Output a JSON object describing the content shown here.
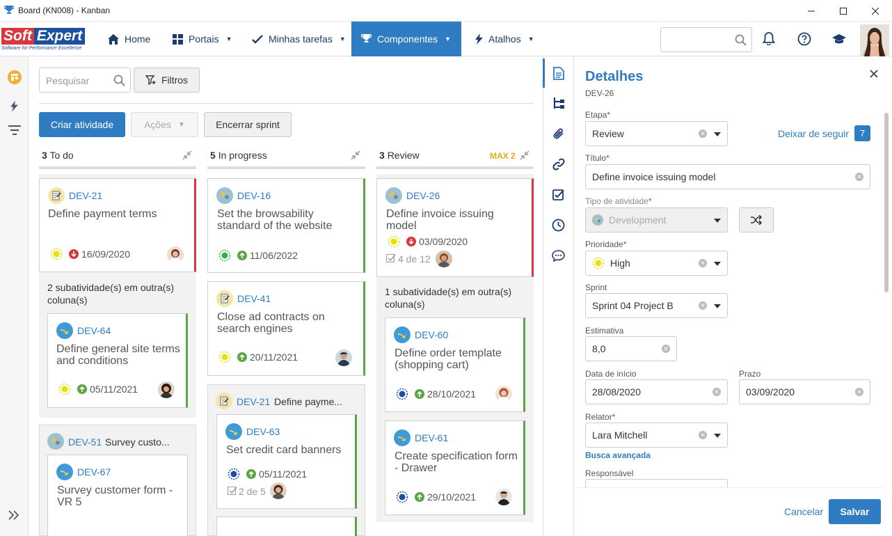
{
  "window": {
    "title": "Board (KN008) - Kanban"
  },
  "logo": {
    "brand_soft": "Soft",
    "brand_expert": "Expert",
    "tagline": "Software for Performance Excellence"
  },
  "nav": {
    "home": "Home",
    "portais": "Portais",
    "minhas_tarefas": "Minhas tarefas",
    "componentes": "Componentes",
    "atalhos": "Atalhos"
  },
  "toolbar": {
    "search_placeholder": "Pesquisar",
    "filters": "Filtros",
    "create": "Criar atividade",
    "actions": "Ações",
    "end_sprint": "Encerrar sprint"
  },
  "columns": [
    {
      "count": "3",
      "name": "To do",
      "max": ""
    },
    {
      "count": "5",
      "name": "In progress",
      "max": ""
    },
    {
      "count": "3",
      "name": "Review",
      "max": "MAX 2"
    }
  ],
  "cards": {
    "dev21": {
      "id": "DEV-21",
      "title": "Define payment terms",
      "date": "16/09/2020"
    },
    "dev64": {
      "id": "DEV-64",
      "title": "Define general site terms and conditions",
      "date": "05/11/2021"
    },
    "dev51": {
      "id": "DEV-51",
      "title": "Survey custo..."
    },
    "dev67": {
      "id": "DEV-67",
      "title": "Survey customer form - VR 5"
    },
    "dev16": {
      "id": "DEV-16",
      "title": "Set the browsability standard of the website",
      "date": "11/06/2022"
    },
    "dev41": {
      "id": "DEV-41",
      "title": "Close ad contracts on search engines",
      "date": "20/11/2021"
    },
    "dev21b": {
      "id": "DEV-21",
      "title": "Define payme..."
    },
    "dev63": {
      "id": "DEV-63",
      "title": "Set credit card banners",
      "date": "05/11/2021",
      "checklist": "2 de 5"
    },
    "dev26": {
      "id": "DEV-26",
      "title": "Define invoice issuing model",
      "date": "03/09/2020",
      "checklist": "4 de 12"
    },
    "dev60": {
      "id": "DEV-60",
      "title": "Define order template (shopping cart)",
      "date": "28/10/2021"
    },
    "dev61": {
      "id": "DEV-61",
      "title": "Create specification form - Drawer",
      "date": "29/10/2021"
    }
  },
  "subtasks": {
    "todo": "2 subatividade(s) em outra(s) coluna(s)",
    "review": "1 subatividade(s) em outra(s) coluna(s)"
  },
  "details": {
    "title": "Detalhes",
    "id": "DEV-26",
    "etapa_label": "Etapa",
    "etapa": "Review",
    "unfollow": "Deixar de seguir",
    "followers": "7",
    "titulo_label": "Título",
    "titulo": "Define invoice issuing model",
    "tipo_label": "Tipo de atividade",
    "tipo": "Development",
    "prioridade_label": "Prioridade",
    "prioridade": "High",
    "sprint_label": "Sprint",
    "sprint": "Sprint 04 Project B",
    "estimativa_label": "Estimativa",
    "estimativa": "8,0",
    "inicio_label": "Data de início",
    "inicio": "28/08/2020",
    "prazo_label": "Prazo",
    "prazo": "03/09/2020",
    "relator_label": "Relator",
    "relator": "Lara Mitchell",
    "busca": "Busca avançada",
    "responsavel_label": "Responsável",
    "cancel": "Cancelar",
    "save": "Salvar"
  },
  "colors": {
    "accent": "#2f7cc3",
    "nav_active": "#2f7cc3",
    "late": "#d9363e",
    "ok": "#5aa544",
    "max": "#e8a818"
  }
}
